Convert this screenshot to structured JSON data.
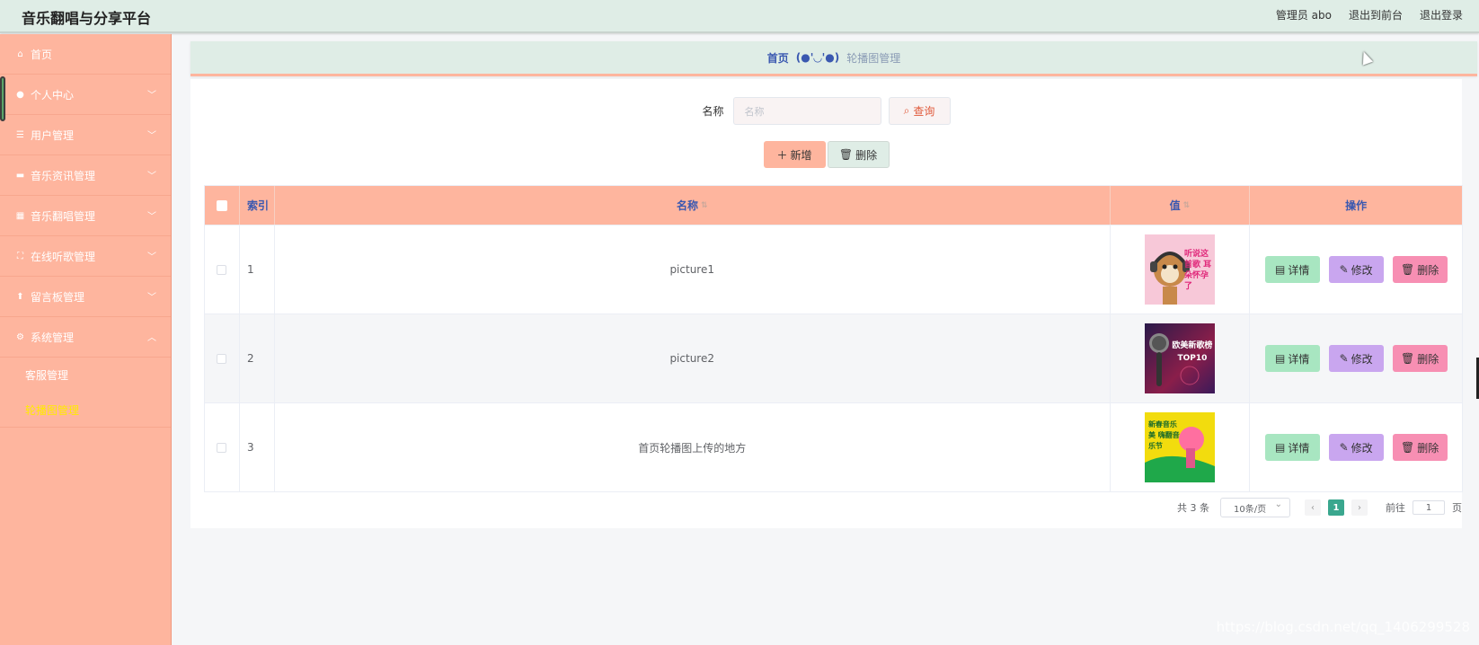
{
  "header": {
    "title": "音乐翻唱与分享平台",
    "user": "管理员 abo",
    "to_front": "退出到前台",
    "logout": "退出登录"
  },
  "sidebar": {
    "items": [
      {
        "label": "首页",
        "icon": "home-icon"
      },
      {
        "label": "个人中心",
        "icon": "user-icon"
      },
      {
        "label": "用户管理",
        "icon": "list-icon"
      },
      {
        "label": "音乐资讯管理",
        "icon": "ticket-icon"
      },
      {
        "label": "音乐翻唱管理",
        "icon": "grid-icon"
      },
      {
        "label": "在线听歌管理",
        "icon": "fullscreen-icon"
      },
      {
        "label": "留言板管理",
        "icon": "upload-user-icon"
      },
      {
        "label": "系统管理",
        "icon": "settings-icon"
      }
    ],
    "sub_items": [
      {
        "label": "客服管理"
      },
      {
        "label": "轮播图管理",
        "active": true
      }
    ]
  },
  "breadcrumb": {
    "home": "首页",
    "face": "(●'◡'●)",
    "current": "轮播图管理"
  },
  "search": {
    "label": "名称",
    "placeholder": "名称",
    "button": "查询"
  },
  "actions": {
    "add": "新增",
    "delete": "删除"
  },
  "table": {
    "headers": {
      "index": "索引",
      "name": "名称",
      "value": "值",
      "ops": "操作"
    },
    "rows": [
      {
        "index": "1",
        "name": "picture1",
        "thumb_text": "听说这首歌 耳朵怀孕了"
      },
      {
        "index": "2",
        "name": "picture2",
        "thumb_text": "欧美新歌榜 TOP10"
      },
      {
        "index": "3",
        "name": "首页轮播图上传的地方",
        "thumb_text": "新春音乐美 嗨翻音乐节"
      }
    ],
    "op_labels": {
      "detail": "详情",
      "edit": "修改",
      "delete": "删除"
    }
  },
  "pagination": {
    "total": "共 3 条",
    "page_size": "10条/页",
    "current": "1",
    "goto_label": "前往",
    "goto_value": "1",
    "page_suffix": "页"
  },
  "watermark": "https://blog.csdn.net/qq_1406299528",
  "colors": {
    "sidebar": "#feb59e",
    "header": "#dfede6",
    "accent_blue": "#3a58b0",
    "detail_btn": "#a8e6c1",
    "edit_btn": "#c9a6ef",
    "delete_btn": "#f78fb3"
  }
}
